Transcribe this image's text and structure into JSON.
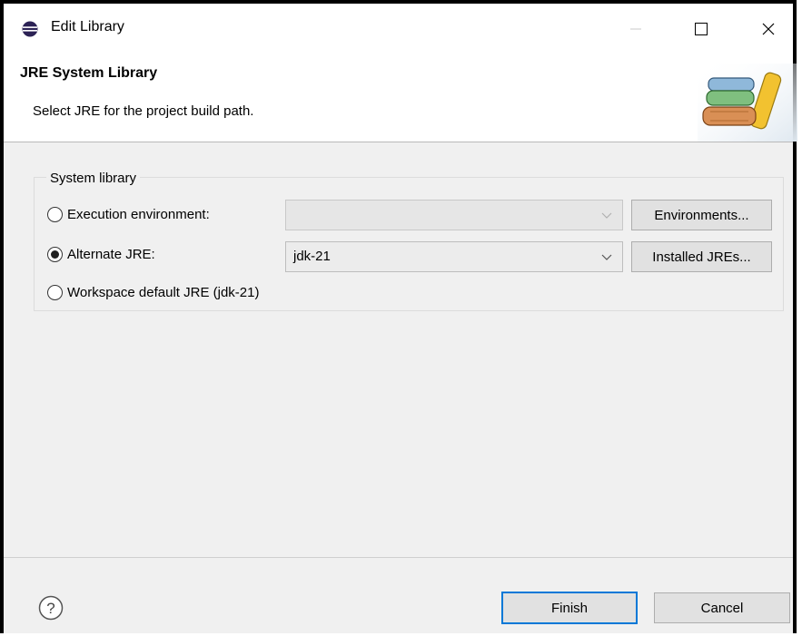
{
  "window": {
    "title": "Edit Library",
    "minimize_icon": "minimize-icon",
    "maximize_icon": "maximize-icon",
    "close_icon": "close-icon"
  },
  "header": {
    "title": "JRE System Library",
    "description": "Select JRE for the project build path.",
    "art_icon": "library-books-icon"
  },
  "group": {
    "label": "System library",
    "options": [
      {
        "label": "Execution environment:",
        "selected": false,
        "combo_value": "",
        "combo_enabled": false,
        "button_label": "Environments..."
      },
      {
        "label": "Alternate JRE:",
        "selected": true,
        "combo_value": "jdk-21",
        "combo_enabled": true,
        "button_label": "Installed JREs..."
      },
      {
        "label": "Workspace default JRE (jdk-21)",
        "selected": false
      }
    ]
  },
  "footer": {
    "help_icon": "help-icon",
    "finish_label": "Finish",
    "cancel_label": "Cancel"
  },
  "colors": {
    "default_button_border": "#0078d7",
    "dialog_background": "#f0f0f0"
  }
}
